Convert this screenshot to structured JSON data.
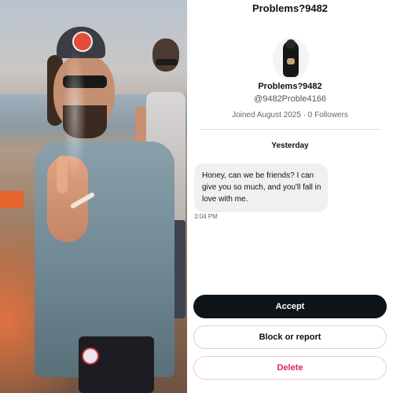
{
  "header": {
    "title": "Problems?9482"
  },
  "profile": {
    "display_name": "Problems?9482",
    "handle": "@9482Proble4166",
    "meta": "Joined August 2025 · 0 Followers"
  },
  "conversation": {
    "day_label": "Yesterday",
    "messages": [
      {
        "text": "Honey, can we be friends? I can give you so much, and you'll fall in love with me.",
        "time": "3:04 PM"
      }
    ]
  },
  "actions": {
    "accept_label": "Accept",
    "block_label": "Block or report",
    "delete_label": "Delete"
  },
  "colors": {
    "accept_bg": "#0f1419",
    "delete_text": "#e0245e",
    "bubble_bg": "#eef0f2"
  }
}
